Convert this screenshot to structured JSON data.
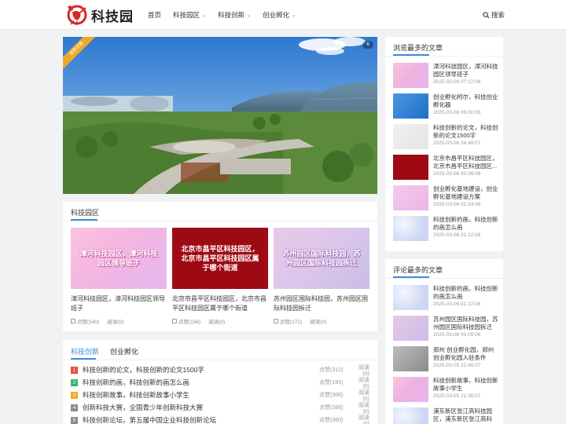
{
  "brand": {
    "logo_text": "科技园"
  },
  "nav": [
    {
      "label": "首页",
      "dropdown": false
    },
    {
      "label": "科技园区",
      "dropdown": true
    },
    {
      "label": "科技创新",
      "dropdown": true
    },
    {
      "label": "创业孵化",
      "dropdown": true
    }
  ],
  "search": {
    "label": "搜索"
  },
  "hero": {
    "ribbon": "推荐文章",
    "count": "6"
  },
  "park_panel": {
    "title": "科技园区",
    "cards": [
      {
        "thumb_text": "漳河科技园区，漳河科技园区领导班子",
        "title": "漳河科技园区，漳河科技园区领导班子",
        "likes": "点赞(240)",
        "reads": "阅读(0)"
      },
      {
        "thumb_text": "北京市昌平区科技园区，北京市昌平区科技园区属于哪个街道",
        "title": "北京市昌平区科技园区，北京市昌平区科技园区属于哪个街道",
        "likes": "点赞(156)",
        "reads": "阅读(0)"
      },
      {
        "thumb_text": "苏州园区国际科技园，苏州园区国际科技园拆迁",
        "title": "苏州园区国际科技园，苏州园区国际科技园拆迁",
        "likes": "点赞(172)",
        "reads": "阅读(0)"
      }
    ]
  },
  "list_panel": {
    "tabs": [
      "科技创新",
      "创业孵化"
    ],
    "rows": [
      {
        "num": "1",
        "title": "科技创新的论文，科技创新的论文1500字",
        "likes": "点赞(312)",
        "reads": "阅读(0)"
      },
      {
        "num": "2",
        "title": "科技创新的画，科技创新的画怎么画",
        "likes": "点赞(195)",
        "reads": "阅读(0)"
      },
      {
        "num": "3",
        "title": "科技创新故事，科技创新故事小学生",
        "likes": "点赞(306)",
        "reads": "阅读(0)"
      },
      {
        "num": "4",
        "title": "创新科技大赛，全国青少年创新科技大赛",
        "likes": "点赞(286)",
        "reads": "阅读(0)"
      },
      {
        "num": "5",
        "title": "科技创新论坛，第五届中国企业科技创新论坛",
        "likes": "点赞(360)",
        "reads": "阅读(0)"
      }
    ]
  },
  "most_viewed": {
    "title": "浏览最多的文章",
    "items": [
      {
        "title": "漳河科技园区，漳河科技园区领导班子",
        "date": "2025-03-06 07:12:06"
      },
      {
        "title": "创业孵化柯尔，科技创业孵化器",
        "date": "2025-03-06 06:00:05"
      },
      {
        "title": "科技创新的论文，科技创新的论文1500字",
        "date": "2025-03-06 04:48:07"
      },
      {
        "title": "北京市昌平区科技园区，北京市昌平区科技园区...",
        "date": "2025-03-06 03:36:06"
      },
      {
        "title": "创业孵化基地建设，创业孵化基地建设方案",
        "date": "2025-03-06 02:24:06"
      },
      {
        "title": "科技创新的画，科技创新的画怎么画",
        "date": "2025-03-06 01:12:06"
      }
    ]
  },
  "most_commented": {
    "title": "评论最多的文章",
    "items": [
      {
        "title": "科技创新的画，科技创新的画怎么画",
        "date": "2025-03-06 01:12:06"
      },
      {
        "title": "苏州园区国际科技园，苏州园区国际科技园拆迁",
        "date": "2025-03-06 00:00:06"
      },
      {
        "title": "郑州 创业孵化园，郑州创业孵化园入驻条件",
        "date": "2025-03-05 22:48:07"
      },
      {
        "title": "科技创新故事，科技创新故事小学生",
        "date": "2025-03-05 21:36:07"
      },
      {
        "title": "浦东新区张江高科技园区，浦东新区张江高科技...",
        "date": ""
      }
    ]
  },
  "colors": {
    "accent": "#3c8cdc",
    "num1": "#e74c3c",
    "num2": "#3cb371",
    "num3": "#f0a82c",
    "num_other": "#8c8c8c"
  }
}
